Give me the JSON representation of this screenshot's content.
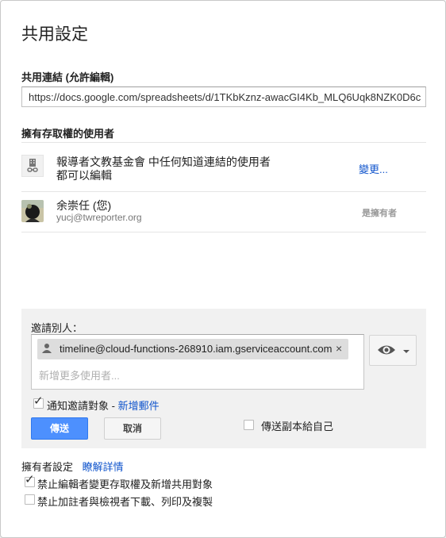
{
  "dialog": {
    "title": "共用設定",
    "link_section_label": "共用連結 (允許編輯)",
    "link_url": "https://docs.google.com/spreadsheets/d/1TKbKznz-awacGI4Kb_MLQ6Uqk8NZK0D6c",
    "access_section_label": "擁有存取權的使用者",
    "org_access": {
      "line1": "報導者文教基金會 中任何知道連結的使用者",
      "line2": "都可以編輯",
      "change_link": "變更...",
      "icon": "building-link-icon"
    },
    "owner": {
      "name": "余崇任 (您)",
      "email": "yucj@twreporter.org",
      "role": "是擁有者",
      "icon": "avatar"
    },
    "invite": {
      "label": "邀請別人：",
      "chip_email": "timeline@cloud-functions-268910.iam.gserviceaccount.com",
      "chip_remove": "×",
      "placeholder": "新增更多使用者...",
      "permission_icon": "eye-icon",
      "notify_label": "通知邀請對象",
      "notify_separator": " - ",
      "add_message_link": "新增郵件",
      "notify_checked": true,
      "send_label": "傳送",
      "cancel_label": "取消",
      "copy_self_label": "傳送副本給自己",
      "copy_self_checked": false
    },
    "owner_settings": {
      "label": "擁有者設定",
      "learn_more": "瞭解詳情",
      "option1": "禁止編輯者變更存取權及新增共用對象",
      "option1_checked": true,
      "option2": "禁止加註者與檢視者下載、列印及複製",
      "option2_checked": false
    }
  },
  "colors": {
    "primary_button": "#4d90fe",
    "link": "#1155cc",
    "panel_bg": "#f1f1f1",
    "chip_bg": "#dddddd"
  }
}
